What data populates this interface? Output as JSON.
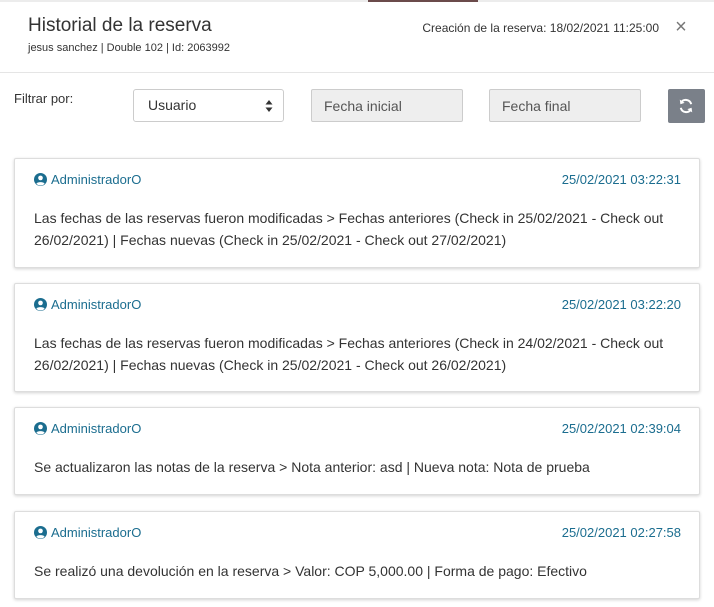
{
  "header": {
    "title": "Historial de la reserva",
    "subtitle": "jesus sanchez | Double 102 | Id: 2063992",
    "created_label": "Creación de la reserva:",
    "created_value": "18/02/2021 11:25:00",
    "close_symbol": "×"
  },
  "filters": {
    "label": "Filtrar por:",
    "select_value": "Usuario",
    "start_placeholder": "Fecha inicial",
    "end_placeholder": "Fecha final",
    "refresh_icon": "refresh-icon"
  },
  "entries": [
    {
      "user": "AdministradorO",
      "date": "25/02/2021 03:22:31",
      "description": "Las fechas de las reservas fueron modificadas > Fechas anteriores (Check in 25/02/2021 - Check out 26/02/2021) | Fechas nuevas (Check in 25/02/2021 - Check out 27/02/2021)"
    },
    {
      "user": "AdministradorO",
      "date": "25/02/2021 03:22:20",
      "description": "Las fechas de las reservas fueron modificadas > Fechas anteriores (Check in 24/02/2021 - Check out 26/02/2021) | Fechas nuevas (Check in 25/02/2021 - Check out 26/02/2021)"
    },
    {
      "user": "AdministradorO",
      "date": "25/02/2021 02:39:04",
      "description": "Se actualizaron las notas de la reserva > Nota anterior: asd | Nueva nota: Nota de prueba"
    },
    {
      "user": "AdministradorO",
      "date": "25/02/2021 02:27:58",
      "description": "Se realizó una devolución en la reserva > Valor: COP 5,000.00 | Forma de pago: Efectivo"
    }
  ],
  "colors": {
    "link": "#1b6d8f",
    "refresh_button": "#7a8089",
    "input_disabled_bg": "#eeeeee"
  }
}
